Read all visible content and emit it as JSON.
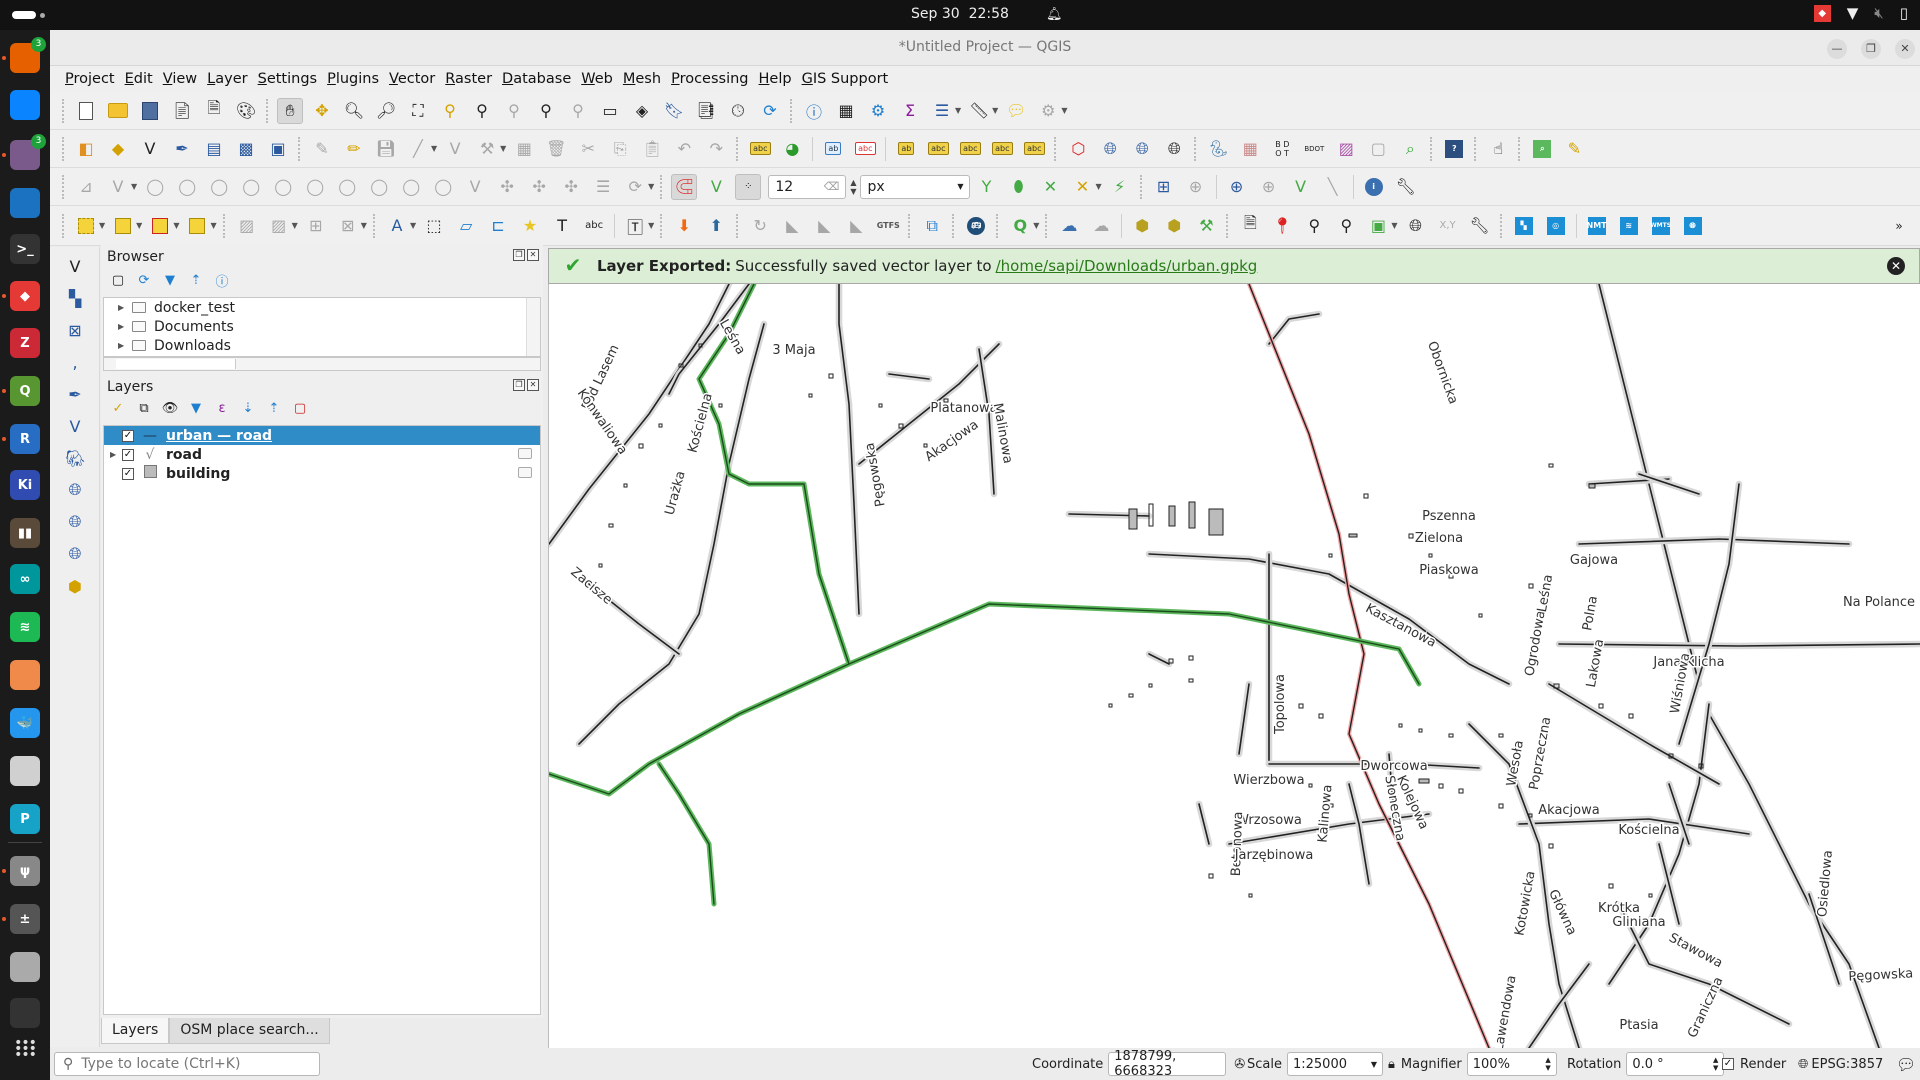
{
  "system": {
    "date": "Sep 30",
    "time": "22:58",
    "tray_icons": [
      "anydesk-icon",
      "wifi-icon",
      "volume-muted-icon",
      "battery-charging-icon"
    ]
  },
  "dock": {
    "apps": [
      {
        "name": "firefox",
        "glyph": "",
        "color": "#e66000",
        "badge": "3",
        "running": true
      },
      {
        "name": "thunderbird",
        "glyph": "",
        "color": "#0a84ff",
        "running": false
      },
      {
        "name": "files",
        "glyph": "",
        "color": "#7a5a8a",
        "badge": "3",
        "running": true
      },
      {
        "name": "writer",
        "glyph": "",
        "color": "#1b72c0",
        "running": false
      },
      {
        "name": "terminal",
        "glyph": ">_",
        "color": "#333",
        "running": false
      },
      {
        "name": "anydesk",
        "glyph": "◆",
        "color": "#e53935",
        "running": true
      },
      {
        "name": "zotero",
        "glyph": "Z",
        "color": "#cc2936",
        "running": false
      },
      {
        "name": "qgis",
        "glyph": "Q",
        "color": "#589632",
        "running": true
      },
      {
        "name": "r",
        "glyph": "R",
        "color": "#276dc3",
        "running": true
      },
      {
        "name": "kicad",
        "glyph": "Ki",
        "color": "#314cb0",
        "running": false
      },
      {
        "name": "books",
        "glyph": "▮▮",
        "color": "#5a4a3a",
        "running": false
      },
      {
        "name": "arduino",
        "glyph": "∞",
        "color": "#00979c",
        "running": false
      },
      {
        "name": "spotify",
        "glyph": "≋",
        "color": "#1db954",
        "running": false
      },
      {
        "name": "mango",
        "glyph": "",
        "color": "#f08a4b",
        "running": false
      },
      {
        "name": "docker",
        "glyph": "🐳",
        "color": "#2496ed",
        "running": false
      },
      {
        "name": "news",
        "glyph": "",
        "color": "#d0d0d0",
        "running": false
      },
      {
        "name": "pcloud",
        "glyph": "P",
        "color": "#17a2c8",
        "running": false
      },
      {
        "name": "usb",
        "glyph": "ψ",
        "color": "#888",
        "running": true
      },
      {
        "name": "calculator",
        "glyph": "±",
        "color": "#555",
        "running": true
      },
      {
        "name": "disks",
        "glyph": "",
        "color": "#aaa",
        "running": false
      },
      {
        "name": "trash",
        "glyph": "",
        "color": "#333",
        "running": false
      }
    ],
    "show_apps_label": "⋮⋮⋮"
  },
  "window": {
    "title": "*Untitled Project — QGIS",
    "controls": [
      "minimize",
      "restore",
      "close"
    ]
  },
  "menu": [
    "Project",
    "Edit",
    "View",
    "Layer",
    "Settings",
    "Plugins",
    "Vector",
    "Raster",
    "Database",
    "Web",
    "Mesh",
    "Processing",
    "Help",
    "GIS Support"
  ],
  "snapping": {
    "tolerance": "12",
    "units": "px"
  },
  "browser": {
    "title": "Browser",
    "items": [
      "docker_test",
      "Documents",
      "Downloads"
    ]
  },
  "layers": {
    "title": "Layers",
    "items": [
      {
        "name": "urban — road",
        "type": "line",
        "checked": true,
        "selected": true
      },
      {
        "name": "road",
        "type": "line-group",
        "checked": true,
        "selected": false
      },
      {
        "name": "building",
        "type": "polygon",
        "checked": true,
        "selected": false
      }
    ]
  },
  "panel_tabs": [
    "Layers",
    "OSM place search..."
  ],
  "message": {
    "title": "Layer Exported:",
    "text": "Successfully saved vector layer to",
    "link": "/home/sapi/Downloads/urban.gpkg"
  },
  "map": {
    "highlight_color": "#5cb85c",
    "main_road_color": "#f4a6a6",
    "street_labels": [
      "Obornicka",
      "Pszenna",
      "Zielona",
      "Piaskowa",
      "Gajowa",
      "Kasztanowa",
      "Topolowa",
      "Na Polance",
      "Jana Klicha",
      "Ogrodowa",
      "Leśna",
      "Lakowa",
      "Polna",
      "Wiśniowa",
      "Wesoła",
      "Poprzeczna",
      "Dworcowa",
      "Wierzbowa",
      "Słoneczna",
      "Kolejowa",
      "Kalinowa",
      "Wrzosowa",
      "Betonowa",
      "Jarzębinowa",
      "Akacjowa",
      "Kościelna",
      "Kotowicka",
      "Główna",
      "Krótka",
      "Gliniana",
      "Stawowa",
      "Pęgowska",
      "Graniczna",
      "Ptasia",
      "Lawendowa",
      "Osiedlowa",
      "3 Maja",
      "Pod Lasem",
      "Konwaliowa",
      "Leśna",
      "Kościelna",
      "Urażka",
      "Zacisze",
      "Platanowa",
      "Akacjowa",
      "Malinowa",
      "Pęgowska"
    ]
  },
  "locator": {
    "placeholder": "Type to locate (Ctrl+K)"
  },
  "status": {
    "coordinate_label": "Coordinate",
    "coordinate": "1878799, 6668323",
    "scale_label": "Scale",
    "scale": "1:25000",
    "magnifier_label": "Magnifier",
    "magnifier": "100%",
    "rotation_label": "Rotation",
    "rotation": "0.0 °",
    "render_label": "Render",
    "render_checked": true,
    "crs": "EPSG:3857"
  }
}
